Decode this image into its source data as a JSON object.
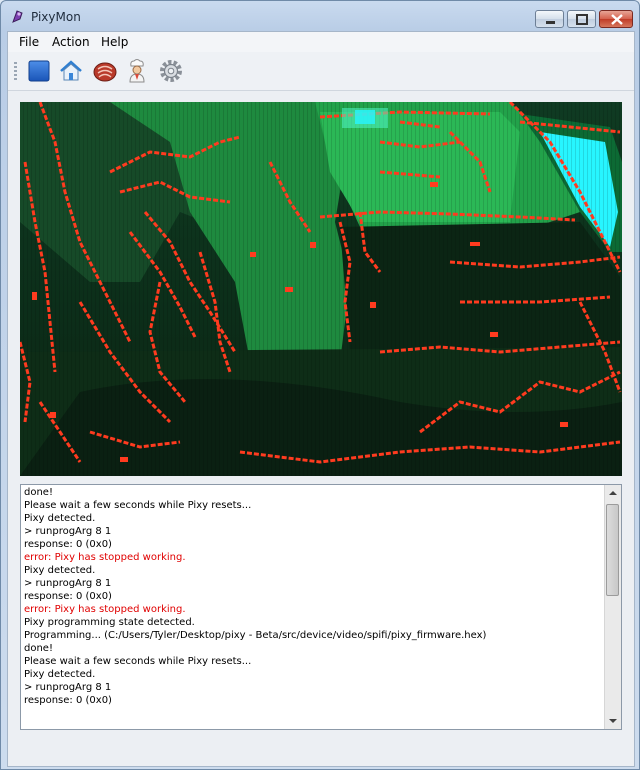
{
  "window": {
    "title": "PixyMon"
  },
  "menu": {
    "items": [
      "File",
      "Action",
      "Help"
    ]
  },
  "toolbar": {
    "buttons": [
      {
        "icon": "stop-icon"
      },
      {
        "icon": "home-icon"
      },
      {
        "icon": "raw-video-icon"
      },
      {
        "icon": "chef-icon"
      },
      {
        "icon": "gear-icon"
      }
    ]
  },
  "console": {
    "lines": [
      {
        "text": "done!",
        "kind": "normal"
      },
      {
        "text": "Please wait a few seconds while Pixy resets...",
        "kind": "normal"
      },
      {
        "text": "Pixy detected.",
        "kind": "normal"
      },
      {
        "text": "> runprogArg 8 1",
        "kind": "normal"
      },
      {
        "text": "response: 0 (0x0)",
        "kind": "normal"
      },
      {
        "text": "error: Pixy has stopped working.",
        "kind": "error"
      },
      {
        "text": "Pixy detected.",
        "kind": "normal"
      },
      {
        "text": "> runprogArg 8 1",
        "kind": "normal"
      },
      {
        "text": "response: 0 (0x0)",
        "kind": "normal"
      },
      {
        "text": "error: Pixy has stopped working.",
        "kind": "error"
      },
      {
        "text": "Pixy programming state detected.",
        "kind": "normal"
      },
      {
        "text": "Programming... (C:/Users/Tyler/Desktop/pixy - Beta/src/device/video/spifi/pixy_firmware.hex)",
        "kind": "normal"
      },
      {
        "text": "done!",
        "kind": "normal"
      },
      {
        "text": "Please wait a few seconds while Pixy resets...",
        "kind": "normal"
      },
      {
        "text": "Pixy detected.",
        "kind": "normal"
      },
      {
        "text": "> runprogArg 8 1",
        "kind": "normal"
      },
      {
        "text": "response: 0 (0x0)",
        "kind": "normal"
      }
    ],
    "error_color": "#e00000"
  },
  "colors": {
    "video_edge": "#ff3b1f",
    "video_green": "#1d8a3c",
    "video_cyan": "#27f5ff"
  }
}
